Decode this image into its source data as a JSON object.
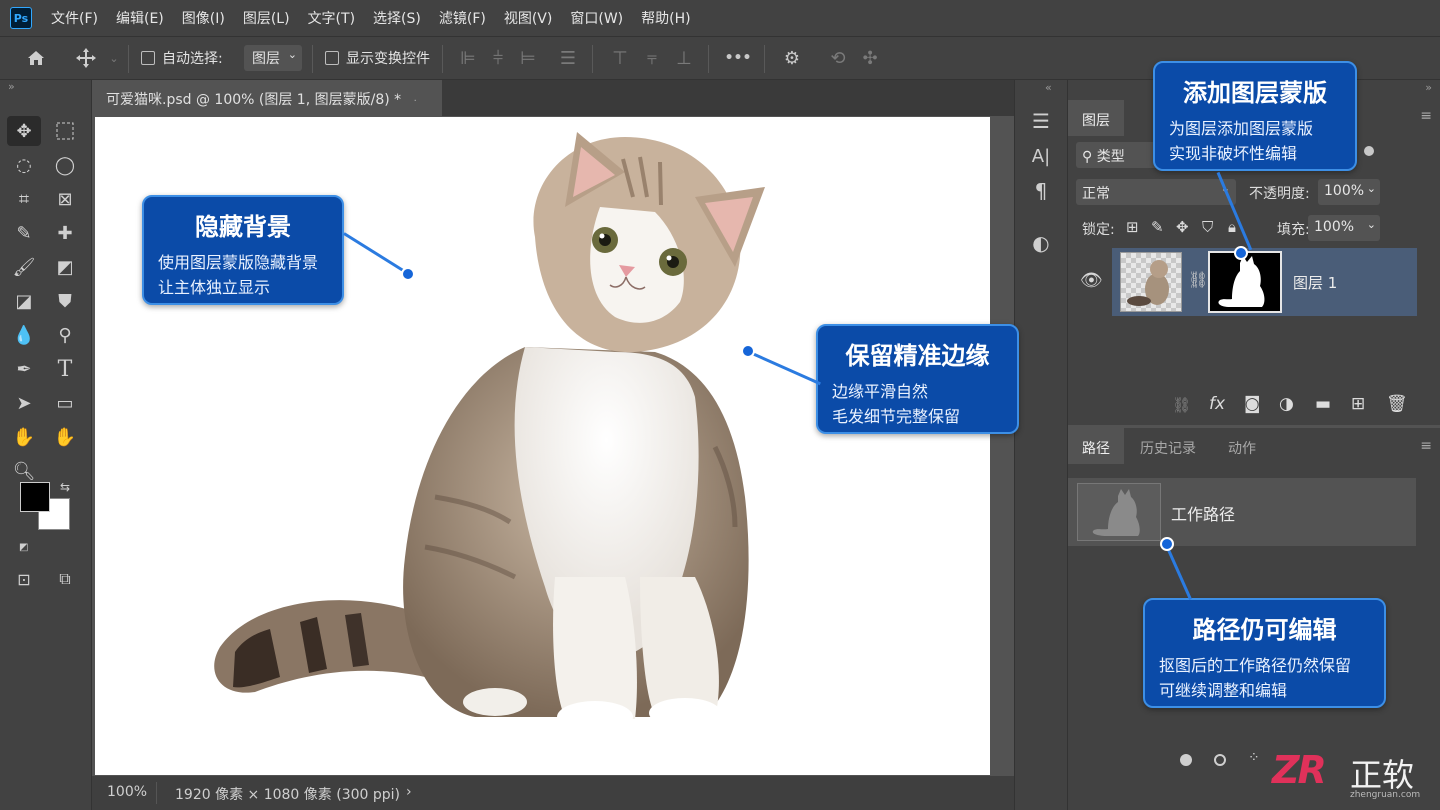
{
  "menubar": {
    "logo": "Ps",
    "items": [
      "文件(F)",
      "编辑(E)",
      "图像(I)",
      "图层(L)",
      "文字(T)",
      "选择(S)",
      "滤镜(F)",
      "视图(V)",
      "窗口(W)",
      "帮助(H)"
    ]
  },
  "options": {
    "auto_select_label": "自动选择:",
    "auto_select_value": "图层",
    "show_transform_label": "显示变换控件",
    "more_label": "•••"
  },
  "document": {
    "tab_title": "可爱猫咪.psd @ 100% (图层 1, 图层蒙版/8) *"
  },
  "status": {
    "zoom": "100%",
    "size": "1920 像素 × 1080 像素 (300 ppi)",
    "arrow": "›"
  },
  "layers_panel": {
    "tab": "图层",
    "filter_label": "类型",
    "blend_mode": "正常",
    "opacity_label": "不透明度:",
    "opacity_value": "100%",
    "lock_label": "锁定:",
    "fill_label": "填充:",
    "fill_value": "100%",
    "layer_name": "图层 1"
  },
  "paths_panel": {
    "tabs": [
      "路径",
      "历史记录",
      "动作"
    ],
    "path_name": "工作路径"
  },
  "callouts": {
    "hide_bg": {
      "title": "隐藏背景",
      "lines": [
        "使用图层蒙版隐藏背景",
        "让主体独立显示"
      ]
    },
    "edge": {
      "title": "保留精准边缘",
      "lines": [
        "边缘平滑自然",
        "毛发细节完整保留"
      ]
    },
    "mask": {
      "title": "添加图层蒙版",
      "lines": [
        "为图层添加图层蒙版",
        "实现非破坏性编辑"
      ]
    },
    "path": {
      "title": "路径仍可编辑",
      "lines": [
        "抠图后的工作路径仍然保留",
        "可继续调整和编辑"
      ]
    }
  },
  "watermark": {
    "logo": "ZR",
    "name": "正软",
    "url": "zhengruan.com"
  },
  "colors": {
    "accent": "#0b4ba8",
    "accent_border": "#3d8fe6",
    "panel": "#424242",
    "selected_layer": "#4a5d78"
  }
}
